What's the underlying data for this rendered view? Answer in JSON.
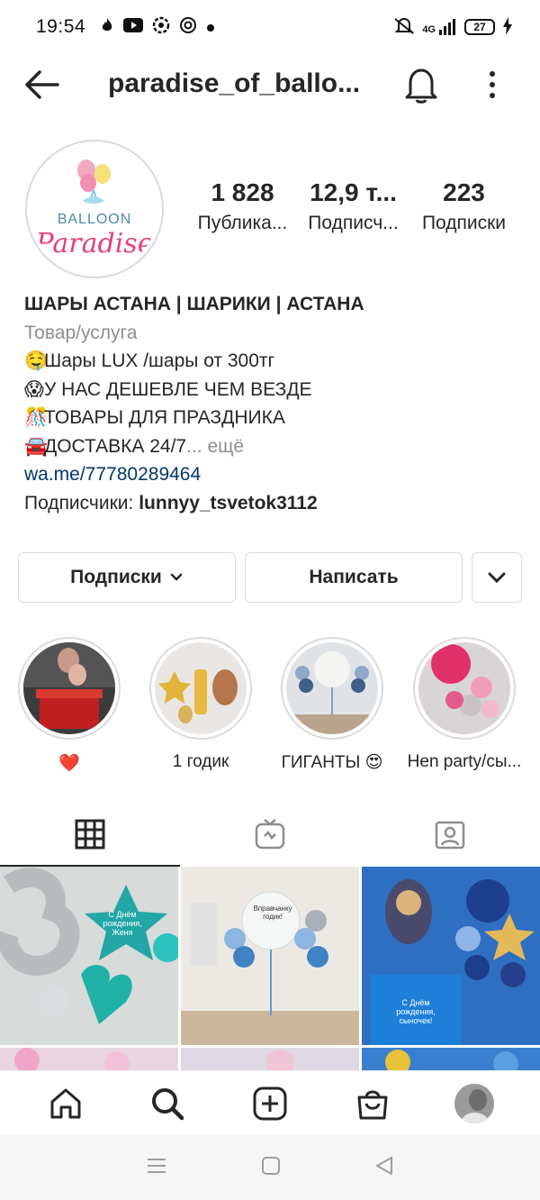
{
  "status_bar": {
    "time": "19:54",
    "network": "4G",
    "battery": "27",
    "notification_icons": [
      "flame-icon",
      "youtube-icon",
      "aperture-icon",
      "at-icon",
      "dot-icon"
    ]
  },
  "header": {
    "username": "paradise_of_ballo..."
  },
  "profile": {
    "avatar_text_top": "BALLOON",
    "avatar_text_bottom": "Paradise",
    "stats": [
      {
        "value": "1 828",
        "label": "Публика..."
      },
      {
        "value": "12,9 т...",
        "label": "Подписч..."
      },
      {
        "value": "223",
        "label": "Подписки"
      }
    ],
    "name": "ШАРЫ АСТАНА | ШАРИКИ | АСТАНА",
    "category": "Товар/услуга",
    "bio_lines": [
      {
        "emoji": "🤤",
        "text": "Шары LUX /шары от 300тг"
      },
      {
        "emoji": "😱",
        "text": "У НАС ДЕШЕВЛЕ ЧЕМ ВЕЗДЕ"
      },
      {
        "emoji": "🎊",
        "text": "ТОВАРЫ ДЛЯ ПРАЗДНИКА"
      },
      {
        "emoji": "🚘",
        "text": "ДОСТАВКА 24/7"
      }
    ],
    "bio_more": "... ещё",
    "link": "wa.me/77780289464",
    "followers_prefix": "Подписчики: ",
    "followers_name": "lunnyy_tsvetok3112"
  },
  "buttons": {
    "following": "Подписки",
    "message": "Написать"
  },
  "highlights": [
    {
      "label": "❤️"
    },
    {
      "label": "1 годик"
    },
    {
      "label": "ГИГАНТЫ 😍"
    },
    {
      "label": "Hen party/сы..."
    }
  ],
  "grid": {
    "cell_texts": [
      "С Днём рождения, Женя",
      "Вправчанку годик!",
      "С Днём рождения, сыночек!"
    ]
  },
  "colors": {
    "link": "#00376b",
    "secondary_text": "#8e8e8e",
    "border": "#dbdbdb",
    "heart": "#ed1c24"
  }
}
